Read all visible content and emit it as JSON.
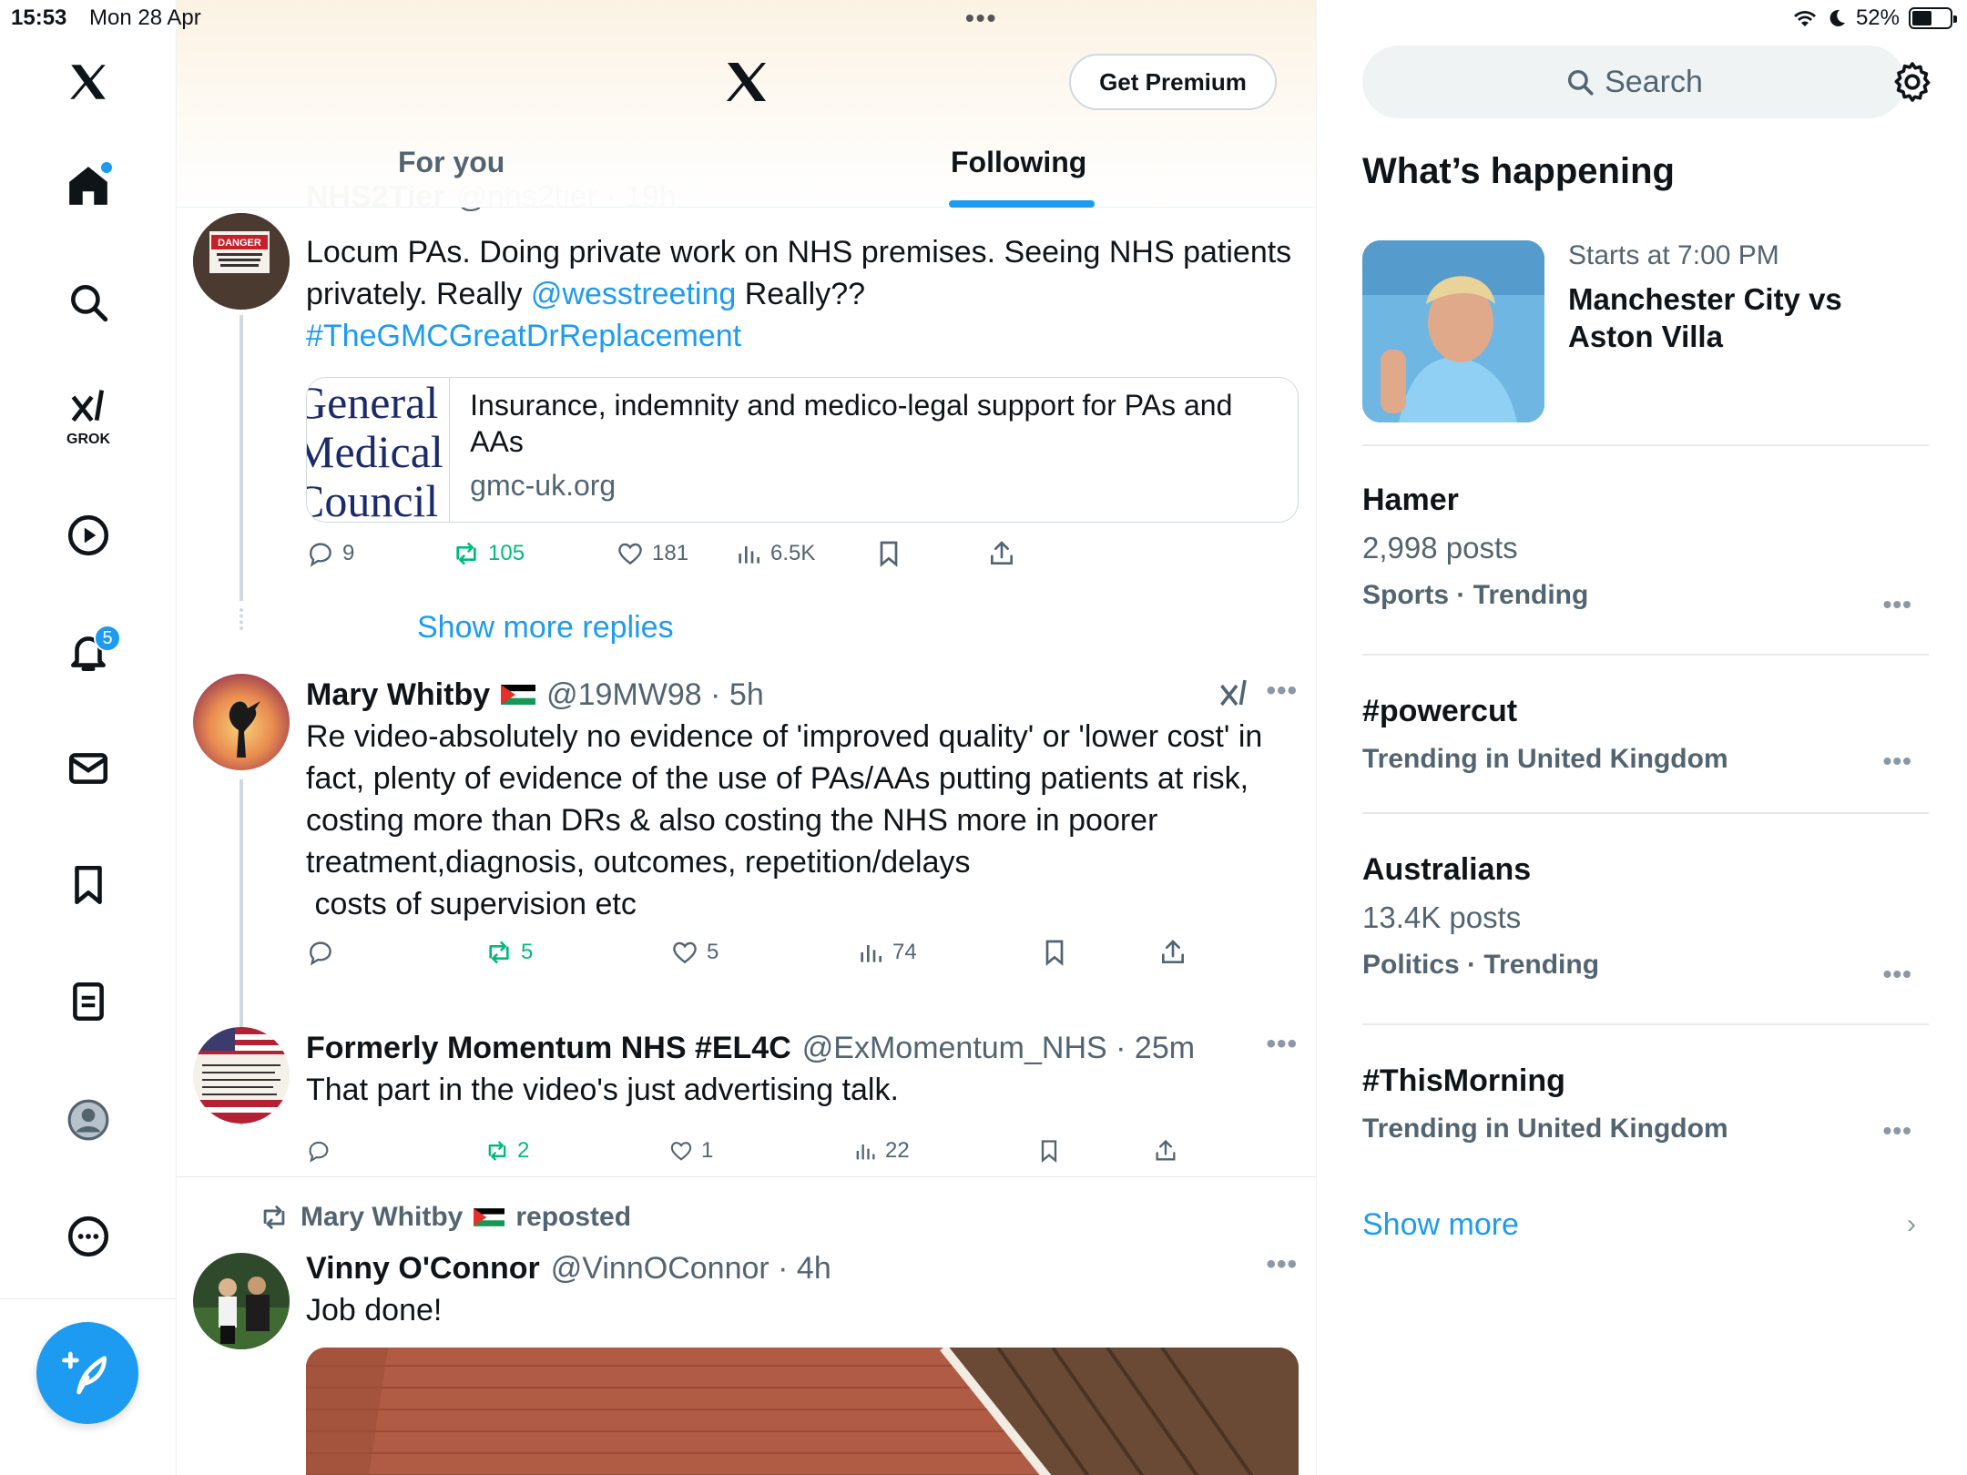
{
  "status_bar": {
    "time": "15:53",
    "date": "Mon 28 Apr",
    "battery": "52%",
    "battery_level": 0.52
  },
  "left_nav": {
    "grok_label": "GROK",
    "notifications_count": "5"
  },
  "feed_header": {
    "premium_button": "Get Premium",
    "tabs": [
      {
        "label": "For you",
        "active": false
      },
      {
        "label": "Following",
        "active": true
      }
    ]
  },
  "tweets": [
    {
      "name_partial": "NHS2Tier",
      "handle_partial": "@nhs2tier · 19h",
      "text_parts": [
        "Locum PAs. Doing private work on NHS premises. Seeing NHS patients privately. Really ",
        "@wesstreeting",
        " Really??",
        "#TheGMCGreatDrReplacement"
      ],
      "link_card": {
        "thumb_lines": [
          "General",
          "Medical",
          "Council"
        ],
        "title": "Insurance, indemnity and medico-legal support for PAs and AAs",
        "domain": "gmc-uk.org"
      },
      "replies": "9",
      "reposts": "105",
      "likes": "181",
      "views": "6.5K"
    },
    {
      "show_more_replies": "Show more replies"
    },
    {
      "name": "Mary Whitby",
      "handle": "@19MW98 · 5h",
      "text_lines": [
        "Re video-absolutely no evidence of 'improved quality' or 'lower cost' in",
        "fact, plenty of evidence of the use of PAs/AAs putting patients at risk,",
        "costing more than DRs & also costing the NHS more in poorer",
        "treatment,diagnosis, outcomes, repetition/delays",
        " costs of supervision etc"
      ],
      "replies": "",
      "reposts": "5",
      "likes": "5",
      "views": "74"
    },
    {
      "name": "Formerly Momentum NHS #EL4C",
      "handle": "@ExMomentum_NHS · 25m",
      "text": "That part in the video's just advertising talk.",
      "replies": "",
      "reposts": "2",
      "likes": "1",
      "views": "22"
    },
    {
      "repost_by": "Mary Whitby",
      "repost_label": "reposted",
      "name": "Vinny O'Connor",
      "handle": "@VinnOConnor · 4h",
      "text": "Job done!"
    }
  ],
  "right_column": {
    "search_placeholder": "Search",
    "whats_happening": "What’s happening",
    "event": {
      "time": "Starts at 7:00 PM",
      "title": "Manchester City vs Aston Villa"
    },
    "trends": [
      {
        "title": "Hamer",
        "posts": "2,998 posts",
        "meta": "Sports · Trending"
      },
      {
        "title": "#powercut",
        "posts": "",
        "meta": "Trending in United Kingdom"
      },
      {
        "title": "Australians",
        "posts": "13.4K posts",
        "meta": "Politics · Trending"
      },
      {
        "title": "#ThisMorning",
        "posts": "",
        "meta": "Trending in United Kingdom"
      }
    ],
    "show_more": "Show more"
  },
  "colors": {
    "accent": "#1d9bf0",
    "repost_green": "#00ba7c",
    "secondary_text": "#536471"
  }
}
